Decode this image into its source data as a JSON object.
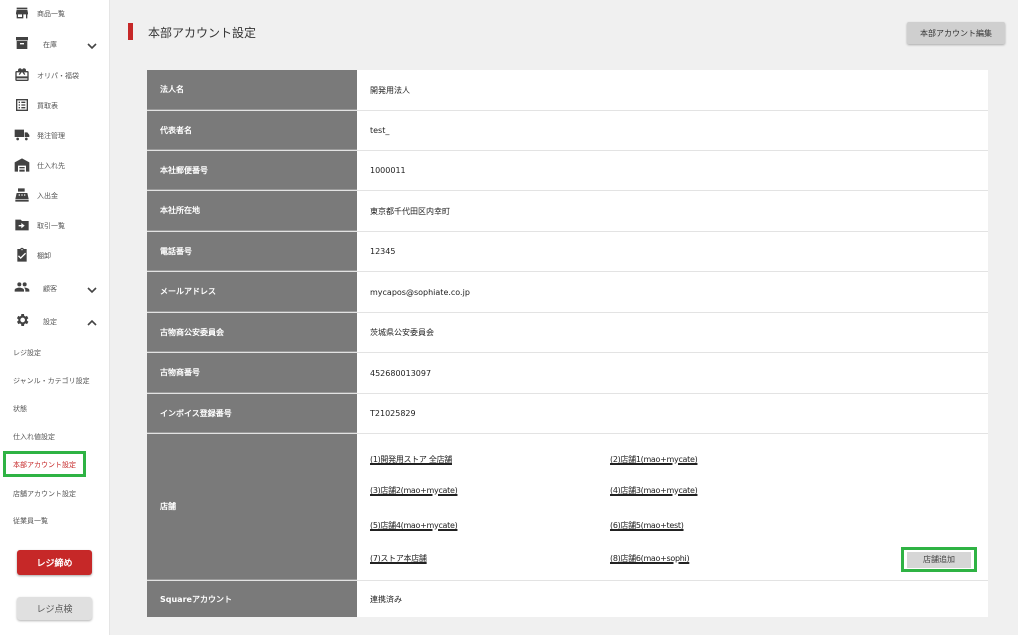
{
  "sidebar": {
    "items": [
      {
        "label": "商品一覧",
        "icon": "store-icon"
      },
      {
        "label": "在庫",
        "icon": "archive-icon"
      },
      {
        "label": "オリパ・福袋",
        "icon": "gift-icon"
      },
      {
        "label": "買取表",
        "icon": "list-icon"
      },
      {
        "label": "発注管理",
        "icon": "truck-icon"
      },
      {
        "label": "仕入れ先",
        "icon": "warehouse-icon"
      },
      {
        "label": "入出金",
        "icon": "register-icon"
      },
      {
        "label": "取引一覧",
        "icon": "folder-icon"
      },
      {
        "label": "棚卸",
        "icon": "clipboard-check-icon"
      },
      {
        "label": "顧客",
        "icon": "people-icon"
      },
      {
        "label": "設定",
        "icon": "gear-icon"
      }
    ],
    "settings_sub": [
      {
        "label": "レジ設定"
      },
      {
        "label": "ジャンル・カテゴリ設定"
      },
      {
        "label": "状態"
      },
      {
        "label": "仕入れ値設定"
      },
      {
        "label": "本部アカウント設定"
      },
      {
        "label": "店舗アカウント設定"
      },
      {
        "label": "従業員一覧"
      }
    ],
    "register_close_label": "レジ締め",
    "register_check_label": "レジ点検"
  },
  "header": {
    "title": "本部アカウント設定",
    "edit_button": "本部アカウント編集"
  },
  "account": {
    "rows": [
      {
        "label": "法人名",
        "value": "開発用法人"
      },
      {
        "label": "代表者名",
        "value": "test_"
      },
      {
        "label": "本社郵便番号",
        "value": "1000011"
      },
      {
        "label": "本社所在地",
        "value": "東京都千代田区内幸町"
      },
      {
        "label": "電話番号",
        "value": "12345"
      },
      {
        "label": "メールアドレス",
        "value": "mycapos@sophiate.co.jp"
      },
      {
        "label": "古物商公安委員会",
        "value": "茨城県公安委員会"
      },
      {
        "label": "古物商番号",
        "value": "452680013097"
      },
      {
        "label": "インボイス登録番号",
        "value": "T21025829"
      }
    ],
    "stores_label": "店舗",
    "stores": [
      {
        "name": "(1)開発用ストア 全店舗"
      },
      {
        "name": "(2)店舗1(mao+mycate)"
      },
      {
        "name": "(3)店舗2(mao+mycate)"
      },
      {
        "name": "(4)店舗3(mao+mycate)"
      },
      {
        "name": "(5)店舗4(mao+mycate)"
      },
      {
        "name": "(6)店舗5(mao+test)"
      },
      {
        "name": "(7)ストア本店舗"
      },
      {
        "name": "(8)店舗6(mao+sophi)"
      }
    ],
    "add_store_button": "店舗追加",
    "square_label": "Squareアカウント",
    "square_value": "連携済み"
  }
}
